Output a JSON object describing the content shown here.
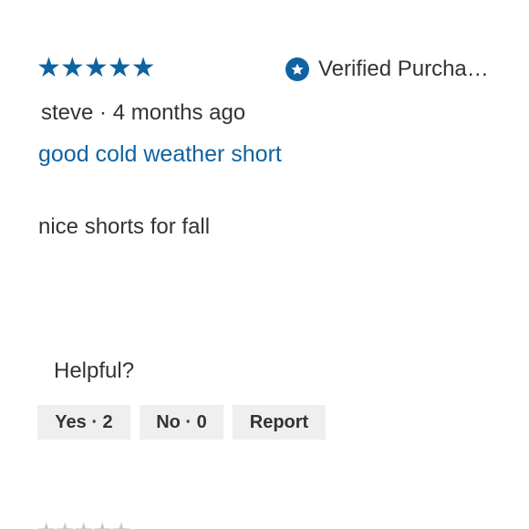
{
  "review": {
    "rating": 5,
    "stars": [
      "★",
      "★",
      "★",
      "★",
      "★"
    ],
    "verified_label": "Verified Purcha…",
    "author": "steve",
    "separator": "·",
    "time_ago": "4 months ago",
    "title": "good cold weather short",
    "body": "nice shorts for fall"
  },
  "helpful": {
    "label": "Helpful?",
    "yes_label": "Yes · 2",
    "no_label": "No · 0",
    "report_label": "Report"
  },
  "next_review": {
    "stars": [
      "★",
      "★",
      "★",
      "★",
      "★"
    ]
  },
  "colors": {
    "accent": "#0f63a1",
    "text": "#333333",
    "button_bg": "#efefef"
  }
}
